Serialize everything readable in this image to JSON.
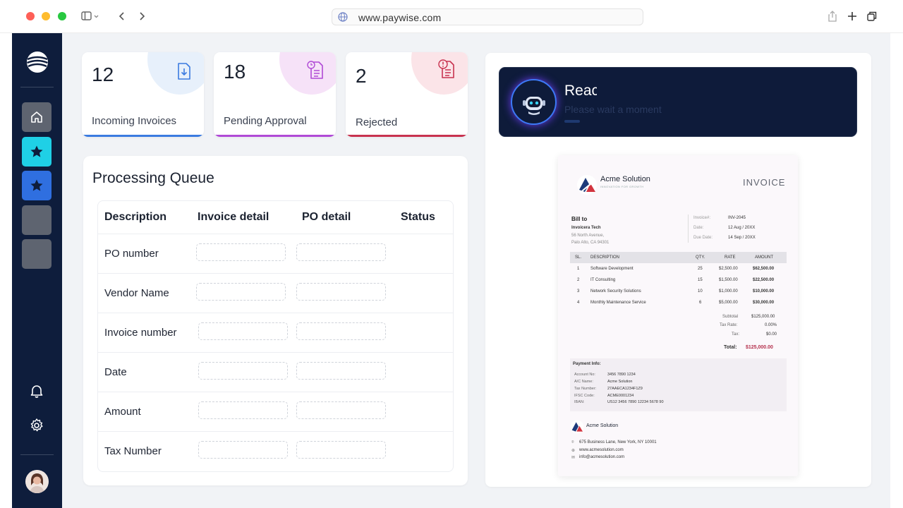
{
  "browser": {
    "url": "www.paywise.com"
  },
  "sidebar": {
    "icons": [
      "home-icon",
      "star-icon",
      "star-icon",
      "bell-icon",
      "gear-icon"
    ]
  },
  "stats": [
    {
      "value": "12",
      "label": "Incoming Invoices",
      "color": "#3b7be0",
      "blob": "#e7f0fb"
    },
    {
      "value": "18",
      "label": "Pending Approval",
      "color": "#b04ad6",
      "blob": "#f6e2f8"
    },
    {
      "value": "2",
      "label": "Rejected",
      "color": "#c8324f",
      "blob": "#fbe4e8"
    }
  ],
  "queue": {
    "title": "Processing Queue",
    "headers": [
      "Description",
      "Invoice detail",
      "PO detail",
      "Status"
    ],
    "rows": [
      "PO number",
      "Vendor Name",
      "Invoice number",
      "Date",
      "Amount",
      "Tax Number"
    ]
  },
  "assistant": {
    "title": "Reac",
    "subtitle": "Please wait a moment"
  },
  "invoice": {
    "company": "Acme Solution",
    "tagline": "INNOVATION FOR GROWTH",
    "heading": "INVOICE",
    "bill_to_label": "Bill to",
    "bill_to_name": "Invoicera Tech",
    "bill_to_addr1": "56 North Avenue,",
    "bill_to_addr2": "Palo Alto, CA 94301",
    "meta": [
      {
        "label": "Invoice#:",
        "value": "INV-2045"
      },
      {
        "label": "Date:",
        "value": "12 Aug / 20XX"
      },
      {
        "label": "Due Date:",
        "value": "14 Sep / 20XX"
      }
    ],
    "columns": [
      "SL.",
      "DESCRIPTION",
      "QTY.",
      "RATE",
      "AMOUNT"
    ],
    "items": [
      [
        "1",
        "Software Development",
        "25",
        "$2,500.00",
        "$62,500.00"
      ],
      [
        "2",
        "IT Consulting",
        "15",
        "$1,500.00",
        "$22,500.00"
      ],
      [
        "3",
        "Network Security Solutions",
        "10",
        "$1,000.00",
        "$10,000.00"
      ],
      [
        "4",
        "Monthly Maintenance Service",
        "6",
        "$5,000.00",
        "$30,000.00"
      ]
    ],
    "totals": [
      {
        "label": "Subtotal",
        "value": "$125,000.00"
      },
      {
        "label": "Tax Rate:",
        "value": "0.00%"
      },
      {
        "label": "Tax:",
        "value": "$0.00"
      }
    ],
    "total_label": "Total:",
    "total_value": "$125,000.00",
    "payment_title": "Payment Info:",
    "payment": [
      {
        "label": "Account No:",
        "value": "3456 7890 1234"
      },
      {
        "label": "A/C Name:",
        "value": "Acme Solution"
      },
      {
        "label": "Tax Number:",
        "value": "27AAECA1234F1Z9"
      },
      {
        "label": "IFSC Code:",
        "value": "ACME0001234"
      },
      {
        "label": "IBAN:",
        "value": "US12 3456 7890 12234 5678 90"
      }
    ],
    "footer_company": "Acme Solution",
    "footer_address": "675 Business Lane, New York, NY 10001",
    "footer_web": "www.acmesolution.com",
    "footer_email": "info@acmesolution.com"
  }
}
